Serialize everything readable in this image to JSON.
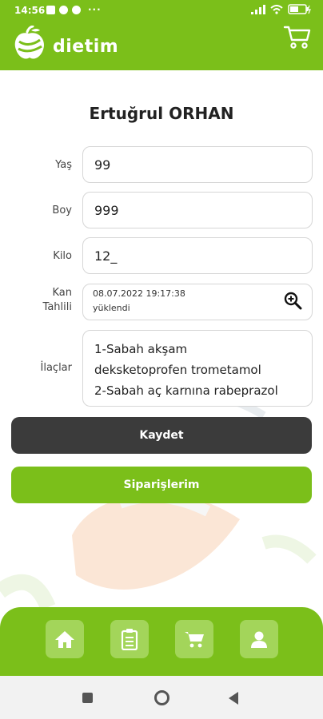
{
  "status_bar": {
    "time": "14:56",
    "more": "···"
  },
  "app": {
    "title": "dietim"
  },
  "profile": {
    "name": "Ertuğrul ORHAN"
  },
  "form": {
    "age": {
      "label": "Yaş",
      "value": "99"
    },
    "height": {
      "label": "Boy",
      "value": "999"
    },
    "weight": {
      "label": "Kilo",
      "value": "12_"
    },
    "blood_test": {
      "label_line1": "Kan",
      "label_line2": "Tahlili",
      "date": "08.07.2022 19:17:38",
      "status": "yüklendi"
    },
    "meds": {
      "label": "İlaçlar",
      "lines": [
        "1-Sabah akşam",
        "deksketoprofen trometamol",
        "2-Sabah aç karnına rabeprazol"
      ]
    }
  },
  "buttons": {
    "save_label": "Kaydet",
    "orders_label": "Siparişlerim"
  },
  "colors": {
    "brand_green": "#7bbf1a",
    "dark_button": "#3b3b3b",
    "nav_tile": "#a3d55a"
  },
  "bottom_nav": {
    "icons": [
      "home-icon",
      "clipboard-icon",
      "cart-icon",
      "user-icon"
    ]
  }
}
